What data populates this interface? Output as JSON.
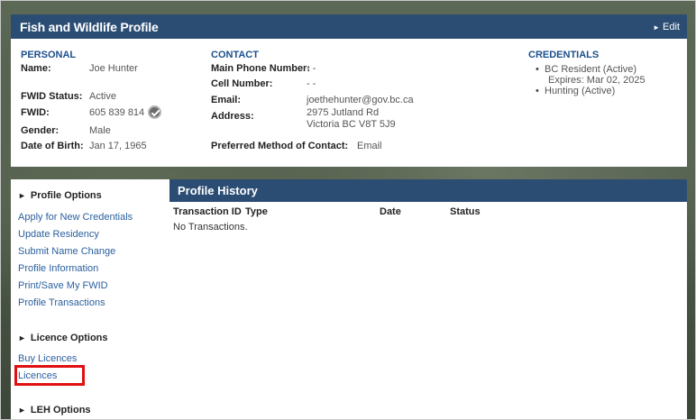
{
  "header": {
    "title": "Fish and Wildlife Profile",
    "edit_label": "Edit"
  },
  "personal": {
    "section_title": "PERSONAL",
    "name_label": "Name:",
    "name_value": "Joe Hunter",
    "fwid_status_label": "FWID Status:",
    "fwid_status_value": "Active",
    "fwid_label": "FWID:",
    "fwid_value": "605 839 814",
    "gender_label": "Gender:",
    "gender_value": "Male",
    "dob_label": "Date of Birth:",
    "dob_value": "Jan 17, 1965"
  },
  "contact": {
    "section_title": "CONTACT",
    "main_phone_label": "Main Phone Number:",
    "main_phone_value": "- -",
    "cell_label": "Cell Number:",
    "cell_value": "- -",
    "email_label": "Email:",
    "email_value": "joethehunter@gov.bc.ca",
    "address_label": "Address:",
    "address_line1": "2975 Jutland Rd",
    "address_line2": "Victoria BC V8T 5J9",
    "preferred_label": "Preferred Method of Contact:",
    "preferred_value": "Email"
  },
  "credentials": {
    "section_title": "CREDENTIALS",
    "items": [
      {
        "name": "BC Resident (Active)",
        "sub": "Expires: Mar 02, 2025"
      },
      {
        "name": "Hunting (Active)"
      }
    ]
  },
  "sidebar": {
    "profile_options": {
      "heading": "Profile Options",
      "links": [
        "Apply for New Credentials",
        "Update Residency",
        "Submit Name Change",
        "Profile Information",
        "Print/Save My FWID",
        "Profile Transactions"
      ]
    },
    "licence_options": {
      "heading": "Licence Options",
      "links": [
        "Buy Licences",
        "Licences"
      ]
    },
    "leh_options": {
      "heading": "LEH Options"
    }
  },
  "main": {
    "title": "Profile History",
    "columns": [
      "Transaction ID",
      "Type",
      "Date",
      "Status"
    ],
    "empty_message": "No Transactions."
  },
  "colors": {
    "brand_bar": "#2b4d74",
    "link": "#2a5f9e",
    "section_title": "#1d4f8c",
    "highlight": "#e01010"
  },
  "icons": {
    "edit": "triangle-right-icon",
    "fwid_check": "check-circle-icon"
  }
}
